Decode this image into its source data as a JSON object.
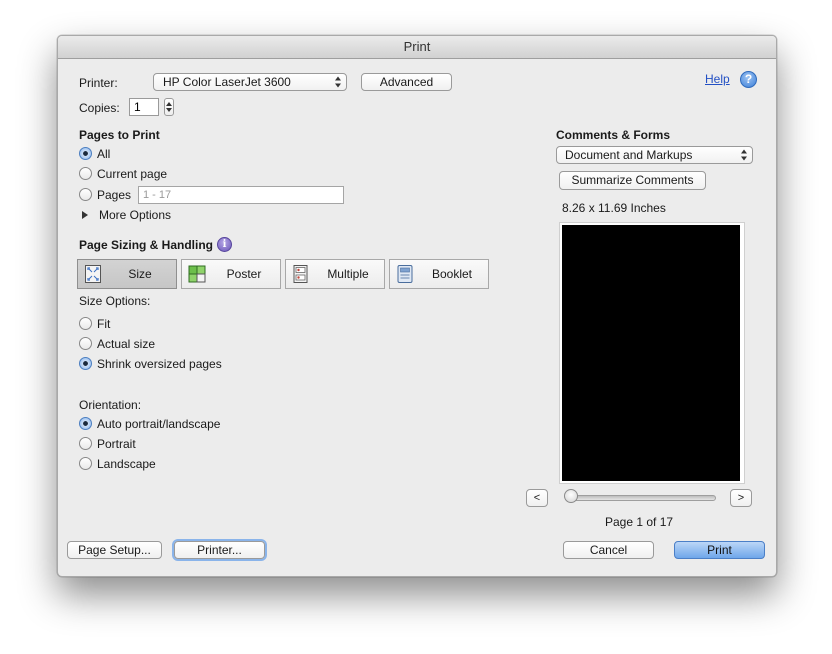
{
  "window": {
    "title": "Print"
  },
  "printer": {
    "label": "Printer:",
    "selected": "HP Color LaserJet 3600",
    "advanced_label": "Advanced",
    "help_label": "Help"
  },
  "copies": {
    "label": "Copies:",
    "value": "1"
  },
  "pages_to_print": {
    "heading": "Pages to Print",
    "options": [
      {
        "label": "All",
        "selected": true
      },
      {
        "label": "Current page",
        "selected": false
      },
      {
        "label": "Pages",
        "selected": false
      }
    ],
    "range_placeholder": "1 - 17",
    "more_options_label": "More Options"
  },
  "page_sizing": {
    "heading": "Page Sizing & Handling",
    "modes": [
      {
        "label": "Size",
        "icon": "size-icon",
        "active": true
      },
      {
        "label": "Poster",
        "icon": "poster-icon",
        "active": false
      },
      {
        "label": "Multiple",
        "icon": "multiple-icon",
        "active": false
      },
      {
        "label": "Booklet",
        "icon": "booklet-icon",
        "active": false
      }
    ],
    "size_options_label": "Size Options:",
    "size_options": [
      {
        "label": "Fit",
        "selected": false
      },
      {
        "label": "Actual size",
        "selected": false
      },
      {
        "label": "Shrink oversized pages",
        "selected": true
      }
    ],
    "orientation_label": "Orientation:",
    "orientation_options": [
      {
        "label": "Auto portrait/landscape",
        "selected": true
      },
      {
        "label": "Portrait",
        "selected": false
      },
      {
        "label": "Landscape",
        "selected": false
      }
    ]
  },
  "comments_forms": {
    "heading": "Comments & Forms",
    "selected": "Document and Markups",
    "summarize_label": "Summarize Comments"
  },
  "preview": {
    "paper_size": "8.26 x 11.69 Inches",
    "prev_label": "<",
    "next_label": ">",
    "page_indicator": "Page 1 of 17",
    "slider_fraction": 0
  },
  "footer": {
    "page_setup_label": "Page Setup...",
    "printer_label": "Printer...",
    "cancel_label": "Cancel",
    "print_label": "Print"
  },
  "colors": {
    "dialog_bg": "#ececec",
    "accent_blue": "#6fa6ea",
    "link": "#2350c4"
  }
}
